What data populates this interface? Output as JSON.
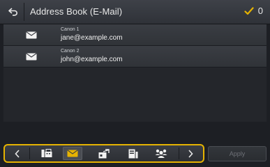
{
  "header": {
    "title": "Address Book (E-Mail)",
    "selected_count": "0"
  },
  "list": {
    "items": [
      {
        "name": "Canon 1",
        "email": "jane@example.com"
      },
      {
        "name": "Canon 2",
        "email": "john@example.com"
      }
    ]
  },
  "toolbar": {
    "buttons": [
      {
        "icon": "chevron-left-icon"
      },
      {
        "icon": "fax-icon"
      },
      {
        "icon": "email-icon",
        "selected": true
      },
      {
        "icon": "shared-folder-icon"
      },
      {
        "icon": "file-server-icon"
      },
      {
        "icon": "group-icon"
      },
      {
        "icon": "chevron-right-icon"
      }
    ],
    "apply_label": "Apply"
  },
  "colors": {
    "accent": "#e6b300",
    "header_bg": "#3a3d43",
    "text": "#e8e8e8"
  }
}
